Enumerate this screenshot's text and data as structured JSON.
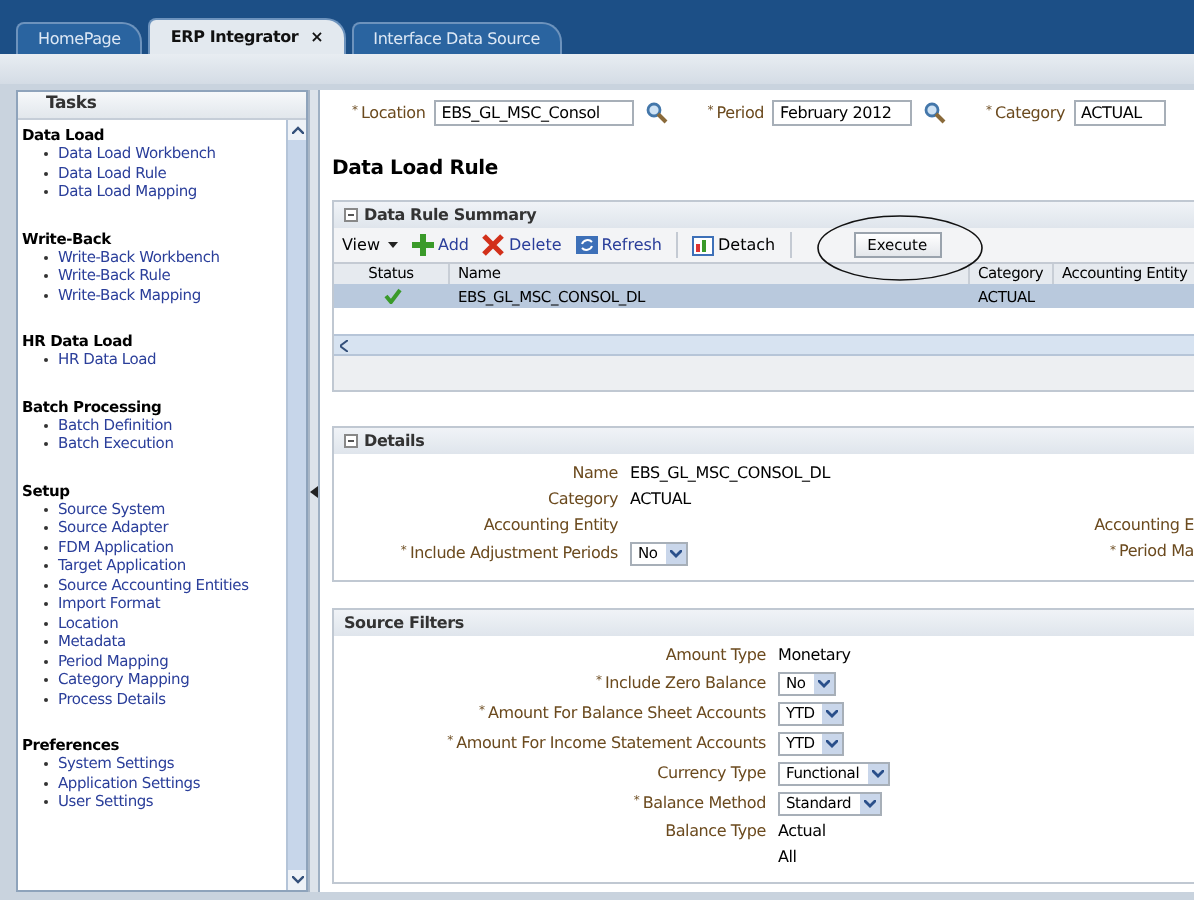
{
  "tabs": [
    {
      "label": "HomePage",
      "selected": false
    },
    {
      "label": "ERP Integrator",
      "selected": true,
      "close": "×"
    },
    {
      "label": "Interface Data Source",
      "selected": false
    }
  ],
  "sidebar": {
    "title": "Tasks",
    "groups": [
      {
        "heading": "Data Load",
        "items": [
          "Data Load Workbench",
          "Data Load Rule",
          "Data Load Mapping"
        ]
      },
      {
        "heading": "Write-Back",
        "items": [
          "Write-Back Workbench",
          "Write-Back Rule",
          "Write-Back Mapping"
        ]
      },
      {
        "heading": "HR Data Load",
        "items": [
          "HR Data Load"
        ]
      },
      {
        "heading": "Batch Processing",
        "items": [
          "Batch Definition",
          "Batch Execution"
        ]
      },
      {
        "heading": "Setup",
        "items": [
          "Source System",
          "Source Adapter",
          "FDM Application",
          "Target Application",
          "Source Accounting Entities",
          "Import Format",
          "Location",
          "Metadata",
          "Period Mapping",
          "Category Mapping",
          "Process Details"
        ]
      },
      {
        "heading": "Preferences",
        "items": [
          "System Settings",
          "Application Settings",
          "User Settings"
        ]
      }
    ]
  },
  "filters": [
    {
      "required_mark": "*",
      "label": "Location",
      "value": "EBS_GL_MSC_Consol",
      "search": true
    },
    {
      "required_mark": "*",
      "label": "Period",
      "value": "February 2012",
      "search": true
    },
    {
      "required_mark": "*",
      "label": "Category",
      "value": "ACTUAL"
    }
  ],
  "page_title": "Data Load Rule",
  "summary": {
    "title": "Data Rule Summary",
    "expanded": true,
    "toolbar": [
      {
        "label": "View",
        "kind": "menu"
      },
      {
        "label": "Add",
        "kind": "add"
      },
      {
        "label": "Delete",
        "kind": "delete"
      },
      {
        "label": "Refresh",
        "kind": "refresh"
      },
      {
        "label": "Detach",
        "kind": "detach"
      },
      {
        "label": "Execute",
        "kind": "button",
        "circled": true
      }
    ],
    "columns": [
      "Status",
      "Name",
      "Category",
      "Accounting Entity"
    ],
    "rows": [
      {
        "status_ok": true,
        "name": "EBS_GL_MSC_CONSOL_DL",
        "category": "ACTUAL",
        "selected": true
      }
    ]
  },
  "details": {
    "title": "Details",
    "expanded": true,
    "fields": [
      {
        "label": "Name",
        "kind": "text",
        "value": "EBS_GL_MSC_CONSOL_DL"
      },
      {
        "label": "Category",
        "kind": "text",
        "value": "ACTUAL"
      },
      {
        "label": "Accounting Entity",
        "kind": "text"
      },
      {
        "required_mark": "*",
        "label": "Include Adjustment Periods",
        "kind": "select",
        "value": "No"
      }
    ],
    "right_fields": [
      {
        "label": "Accounting E"
      },
      {
        "required_mark": "*",
        "label": "Period Ma"
      }
    ]
  },
  "source_filters": {
    "title": "Source Filters",
    "fields": [
      {
        "label": "Amount Type",
        "kind": "text",
        "value": "Monetary"
      },
      {
        "required_mark": "*",
        "label": "Include Zero Balance",
        "kind": "select",
        "value": "No"
      },
      {
        "required_mark": "*",
        "label": "Amount For Balance Sheet Accounts",
        "kind": "select",
        "value": "YTD"
      },
      {
        "required_mark": "*",
        "label": "Amount For Income Statement Accounts",
        "kind": "select",
        "value": "YTD"
      },
      {
        "label": "Currency Type",
        "kind": "select",
        "value": "Functional"
      },
      {
        "required_mark": "*",
        "label": "Balance Method",
        "kind": "select",
        "value": "Standard"
      },
      {
        "label": "Balance Type",
        "kind": "text",
        "value": "Actual"
      },
      {
        "kind": "text",
        "value": "All"
      }
    ]
  }
}
